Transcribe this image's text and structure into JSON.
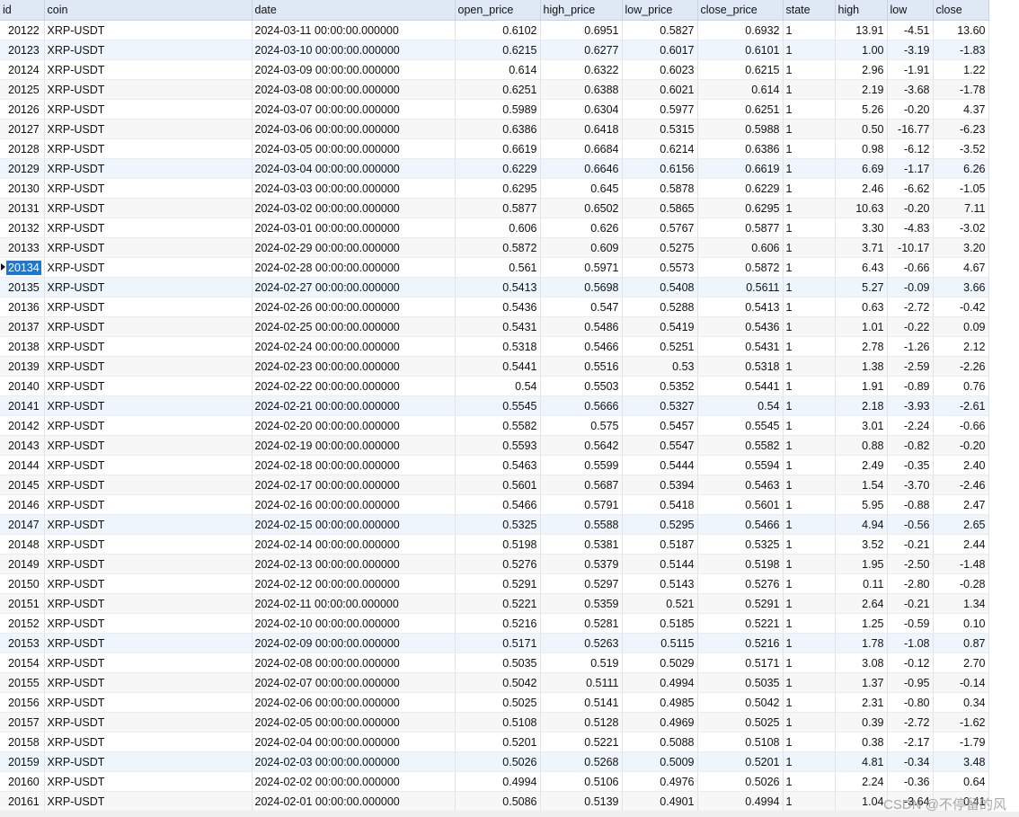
{
  "columns": [
    "id",
    "coin",
    "date",
    "open_price",
    "high_price",
    "low_price",
    "close_price",
    "state",
    "high",
    "low",
    "close"
  ],
  "column_align": [
    "left",
    "left",
    "left",
    "right",
    "right",
    "right",
    "right",
    "left",
    "right",
    "right",
    "right"
  ],
  "selected_row_id": "20134",
  "highlighted_row_ids": [
    "20123",
    "20129",
    "20135",
    "20141",
    "20147",
    "20153",
    "20159"
  ],
  "rows": [
    [
      "20122",
      "XRP-USDT",
      "2024-03-11 00:00:00.000000",
      "0.6102",
      "0.6951",
      "0.5827",
      "0.6932",
      "1",
      "13.91",
      "-4.51",
      "13.60"
    ],
    [
      "20123",
      "XRP-USDT",
      "2024-03-10 00:00:00.000000",
      "0.6215",
      "0.6277",
      "0.6017",
      "0.6101",
      "1",
      "1.00",
      "-3.19",
      "-1.83"
    ],
    [
      "20124",
      "XRP-USDT",
      "2024-03-09 00:00:00.000000",
      "0.614",
      "0.6322",
      "0.6023",
      "0.6215",
      "1",
      "2.96",
      "-1.91",
      "1.22"
    ],
    [
      "20125",
      "XRP-USDT",
      "2024-03-08 00:00:00.000000",
      "0.6251",
      "0.6388",
      "0.6021",
      "0.614",
      "1",
      "2.19",
      "-3.68",
      "-1.78"
    ],
    [
      "20126",
      "XRP-USDT",
      "2024-03-07 00:00:00.000000",
      "0.5989",
      "0.6304",
      "0.5977",
      "0.6251",
      "1",
      "5.26",
      "-0.20",
      "4.37"
    ],
    [
      "20127",
      "XRP-USDT",
      "2024-03-06 00:00:00.000000",
      "0.6386",
      "0.6418",
      "0.5315",
      "0.5988",
      "1",
      "0.50",
      "-16.77",
      "-6.23"
    ],
    [
      "20128",
      "XRP-USDT",
      "2024-03-05 00:00:00.000000",
      "0.6619",
      "0.6684",
      "0.6214",
      "0.6386",
      "1",
      "0.98",
      "-6.12",
      "-3.52"
    ],
    [
      "20129",
      "XRP-USDT",
      "2024-03-04 00:00:00.000000",
      "0.6229",
      "0.6646",
      "0.6156",
      "0.6619",
      "1",
      "6.69",
      "-1.17",
      "6.26"
    ],
    [
      "20130",
      "XRP-USDT",
      "2024-03-03 00:00:00.000000",
      "0.6295",
      "0.645",
      "0.5878",
      "0.6229",
      "1",
      "2.46",
      "-6.62",
      "-1.05"
    ],
    [
      "20131",
      "XRP-USDT",
      "2024-03-02 00:00:00.000000",
      "0.5877",
      "0.6502",
      "0.5865",
      "0.6295",
      "1",
      "10.63",
      "-0.20",
      "7.11"
    ],
    [
      "20132",
      "XRP-USDT",
      "2024-03-01 00:00:00.000000",
      "0.606",
      "0.626",
      "0.5767",
      "0.5877",
      "1",
      "3.30",
      "-4.83",
      "-3.02"
    ],
    [
      "20133",
      "XRP-USDT",
      "2024-02-29 00:00:00.000000",
      "0.5872",
      "0.609",
      "0.5275",
      "0.606",
      "1",
      "3.71",
      "-10.17",
      "3.20"
    ],
    [
      "20134",
      "XRP-USDT",
      "2024-02-28 00:00:00.000000",
      "0.561",
      "0.5971",
      "0.5573",
      "0.5872",
      "1",
      "6.43",
      "-0.66",
      "4.67"
    ],
    [
      "20135",
      "XRP-USDT",
      "2024-02-27 00:00:00.000000",
      "0.5413",
      "0.5698",
      "0.5408",
      "0.5611",
      "1",
      "5.27",
      "-0.09",
      "3.66"
    ],
    [
      "20136",
      "XRP-USDT",
      "2024-02-26 00:00:00.000000",
      "0.5436",
      "0.547",
      "0.5288",
      "0.5413",
      "1",
      "0.63",
      "-2.72",
      "-0.42"
    ],
    [
      "20137",
      "XRP-USDT",
      "2024-02-25 00:00:00.000000",
      "0.5431",
      "0.5486",
      "0.5419",
      "0.5436",
      "1",
      "1.01",
      "-0.22",
      "0.09"
    ],
    [
      "20138",
      "XRP-USDT",
      "2024-02-24 00:00:00.000000",
      "0.5318",
      "0.5466",
      "0.5251",
      "0.5431",
      "1",
      "2.78",
      "-1.26",
      "2.12"
    ],
    [
      "20139",
      "XRP-USDT",
      "2024-02-23 00:00:00.000000",
      "0.5441",
      "0.5516",
      "0.53",
      "0.5318",
      "1",
      "1.38",
      "-2.59",
      "-2.26"
    ],
    [
      "20140",
      "XRP-USDT",
      "2024-02-22 00:00:00.000000",
      "0.54",
      "0.5503",
      "0.5352",
      "0.5441",
      "1",
      "1.91",
      "-0.89",
      "0.76"
    ],
    [
      "20141",
      "XRP-USDT",
      "2024-02-21 00:00:00.000000",
      "0.5545",
      "0.5666",
      "0.5327",
      "0.54",
      "1",
      "2.18",
      "-3.93",
      "-2.61"
    ],
    [
      "20142",
      "XRP-USDT",
      "2024-02-20 00:00:00.000000",
      "0.5582",
      "0.575",
      "0.5457",
      "0.5545",
      "1",
      "3.01",
      "-2.24",
      "-0.66"
    ],
    [
      "20143",
      "XRP-USDT",
      "2024-02-19 00:00:00.000000",
      "0.5593",
      "0.5642",
      "0.5547",
      "0.5582",
      "1",
      "0.88",
      "-0.82",
      "-0.20"
    ],
    [
      "20144",
      "XRP-USDT",
      "2024-02-18 00:00:00.000000",
      "0.5463",
      "0.5599",
      "0.5444",
      "0.5594",
      "1",
      "2.49",
      "-0.35",
      "2.40"
    ],
    [
      "20145",
      "XRP-USDT",
      "2024-02-17 00:00:00.000000",
      "0.5601",
      "0.5687",
      "0.5394",
      "0.5463",
      "1",
      "1.54",
      "-3.70",
      "-2.46"
    ],
    [
      "20146",
      "XRP-USDT",
      "2024-02-16 00:00:00.000000",
      "0.5466",
      "0.5791",
      "0.5418",
      "0.5601",
      "1",
      "5.95",
      "-0.88",
      "2.47"
    ],
    [
      "20147",
      "XRP-USDT",
      "2024-02-15 00:00:00.000000",
      "0.5325",
      "0.5588",
      "0.5295",
      "0.5466",
      "1",
      "4.94",
      "-0.56",
      "2.65"
    ],
    [
      "20148",
      "XRP-USDT",
      "2024-02-14 00:00:00.000000",
      "0.5198",
      "0.5381",
      "0.5187",
      "0.5325",
      "1",
      "3.52",
      "-0.21",
      "2.44"
    ],
    [
      "20149",
      "XRP-USDT",
      "2024-02-13 00:00:00.000000",
      "0.5276",
      "0.5379",
      "0.5144",
      "0.5198",
      "1",
      "1.95",
      "-2.50",
      "-1.48"
    ],
    [
      "20150",
      "XRP-USDT",
      "2024-02-12 00:00:00.000000",
      "0.5291",
      "0.5297",
      "0.5143",
      "0.5276",
      "1",
      "0.11",
      "-2.80",
      "-0.28"
    ],
    [
      "20151",
      "XRP-USDT",
      "2024-02-11 00:00:00.000000",
      "0.5221",
      "0.5359",
      "0.521",
      "0.5291",
      "1",
      "2.64",
      "-0.21",
      "1.34"
    ],
    [
      "20152",
      "XRP-USDT",
      "2024-02-10 00:00:00.000000",
      "0.5216",
      "0.5281",
      "0.5185",
      "0.5221",
      "1",
      "1.25",
      "-0.59",
      "0.10"
    ],
    [
      "20153",
      "XRP-USDT",
      "2024-02-09 00:00:00.000000",
      "0.5171",
      "0.5263",
      "0.5115",
      "0.5216",
      "1",
      "1.78",
      "-1.08",
      "0.87"
    ],
    [
      "20154",
      "XRP-USDT",
      "2024-02-08 00:00:00.000000",
      "0.5035",
      "0.519",
      "0.5029",
      "0.5171",
      "1",
      "3.08",
      "-0.12",
      "2.70"
    ],
    [
      "20155",
      "XRP-USDT",
      "2024-02-07 00:00:00.000000",
      "0.5042",
      "0.5111",
      "0.4994",
      "0.5035",
      "1",
      "1.37",
      "-0.95",
      "-0.14"
    ],
    [
      "20156",
      "XRP-USDT",
      "2024-02-06 00:00:00.000000",
      "0.5025",
      "0.5141",
      "0.4985",
      "0.5042",
      "1",
      "2.31",
      "-0.80",
      "0.34"
    ],
    [
      "20157",
      "XRP-USDT",
      "2024-02-05 00:00:00.000000",
      "0.5108",
      "0.5128",
      "0.4969",
      "0.5025",
      "1",
      "0.39",
      "-2.72",
      "-1.62"
    ],
    [
      "20158",
      "XRP-USDT",
      "2024-02-04 00:00:00.000000",
      "0.5201",
      "0.5221",
      "0.5088",
      "0.5108",
      "1",
      "0.38",
      "-2.17",
      "-1.79"
    ],
    [
      "20159",
      "XRP-USDT",
      "2024-02-03 00:00:00.000000",
      "0.5026",
      "0.5268",
      "0.5009",
      "0.5201",
      "1",
      "4.81",
      "-0.34",
      "3.48"
    ],
    [
      "20160",
      "XRP-USDT",
      "2024-02-02 00:00:00.000000",
      "0.4994",
      "0.5106",
      "0.4976",
      "0.5026",
      "1",
      "2.24",
      "-0.36",
      "0.64"
    ],
    [
      "20161",
      "XRP-USDT",
      "2024-02-01 00:00:00.000000",
      "0.5086",
      "0.5139",
      "0.4901",
      "0.4994",
      "1",
      "1.04",
      "-3.64",
      "0.41"
    ]
  ],
  "watermark": "CSDN @不停留的风"
}
